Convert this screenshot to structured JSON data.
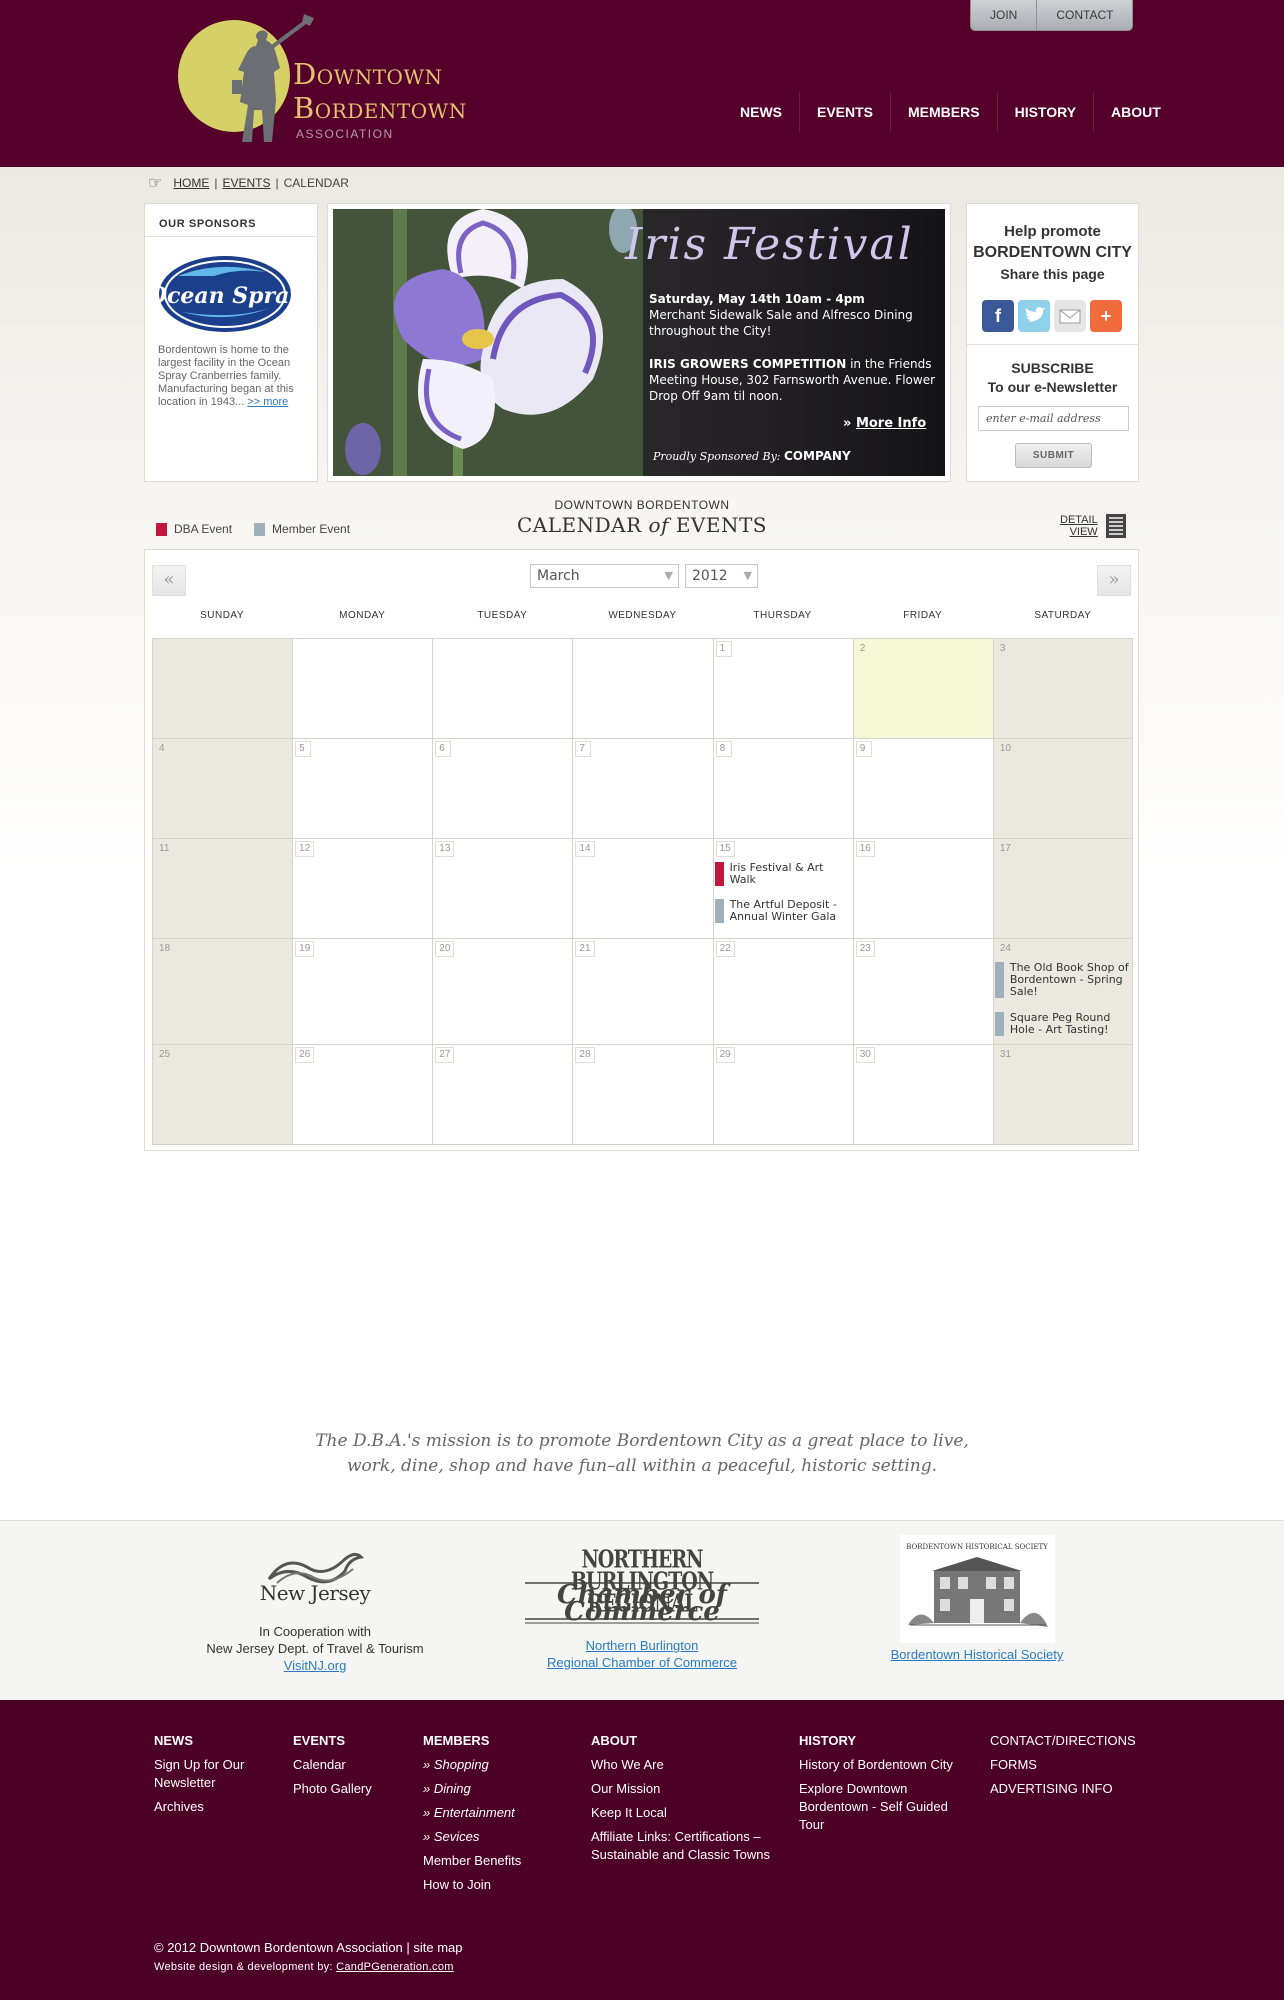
{
  "header": {
    "logo_line1": "Downtown",
    "logo_line2": "Bordentown",
    "logo_sub": "ASSOCIATION",
    "util_nav": [
      "JOIN",
      "CONTACT"
    ],
    "main_nav": [
      "NEWS",
      "EVENTS",
      "MEMBERS",
      "HISTORY",
      "ABOUT"
    ]
  },
  "breadcrumb": {
    "home": "HOME",
    "sep1": "|",
    "events": "EVENTS",
    "sep2": "|",
    "current": "CALENDAR"
  },
  "sponsors": {
    "title": "OUR SPONSORS",
    "logo_text": "Ocean Spray",
    "text": "Bordentown is home to the largest facility in the Ocean Spray Cranberries family. Manufacturing began at this location in 1943...",
    "more": ">> more"
  },
  "hero": {
    "title": "Iris Festival",
    "line1": "Saturday, May 14th 10am - 4pm",
    "line2": "Merchant Sidewalk Sale and Alfresco Dining throughout the City!",
    "line3_bold": "IRIS GROWERS COMPETITION",
    "line3_rest": " in the Friends Meeting House, 302 Farnsworth Avenue. Flower Drop Off 9am til noon.",
    "more_prefix": "» ",
    "more": "More Info",
    "sponsor_label": "Proudly Sponsored By: ",
    "sponsor_name": "COMPANY"
  },
  "promote": {
    "line1": "Help promote",
    "line2": "BORDENTOWN CITY",
    "line3": "Share this page",
    "share_icons": [
      "facebook-icon",
      "twitter-icon",
      "email-icon",
      "addthis-icon"
    ],
    "subscribe_l1": "SUBSCRIBE",
    "subscribe_l2": "To our e-Newsletter",
    "email_placeholder": "enter e-mail address",
    "submit": "SUBMIT"
  },
  "legend": [
    {
      "label": "DBA Event",
      "color": "#c4173f"
    },
    {
      "label": "Member Event",
      "color": "#9fb0ba"
    }
  ],
  "calendar": {
    "org": "DOWNTOWN BORDENTOWN",
    "title_a": "CALENDAR ",
    "title_of": "of",
    "title_b": " EVENTS",
    "detail_view_1": "DETAIL",
    "detail_view_2": "VIEW",
    "prev": "«",
    "next": "»",
    "month": "March",
    "year": "2012",
    "weekdays": [
      "SUNDAY",
      "MONDAY",
      "TUESDAY",
      "WEDNESDAY",
      "THURSDAY",
      "FRIDAY",
      "SATURDAY"
    ],
    "weeks": [
      [
        "",
        "",
        "",
        "",
        "1",
        "2",
        "3"
      ],
      [
        "4",
        "5",
        "6",
        "7",
        "8",
        "9",
        "10"
      ],
      [
        "11",
        "12",
        "13",
        "14",
        "15",
        "16",
        "17"
      ],
      [
        "18",
        "19",
        "20",
        "21",
        "22",
        "23",
        "24"
      ],
      [
        "25",
        "26",
        "27",
        "28",
        "29",
        "30",
        "31"
      ]
    ],
    "today": "2",
    "events": [
      {
        "day": "15",
        "type": "dba",
        "title": "Iris Festival & Art Walk"
      },
      {
        "day": "15",
        "type": "member",
        "title": "The Artful Deposit - Annual Winter Gala"
      },
      {
        "day": "24",
        "type": "member",
        "title": "The Old Book Shop of Bordentown - Spring Sale!"
      },
      {
        "day": "24",
        "type": "member",
        "title": "Square Peg Round Hole - Art Tasting!"
      }
    ]
  },
  "mission": {
    "line1": "The D.B.A.'s mission is to promote Bordentown City as a great place to live,",
    "line2": "work, dine, shop and have fun–all within a peaceful, historic setting."
  },
  "partners": {
    "nj_logo": "New Jersey",
    "nj_l1": "In Cooperation with",
    "nj_l2": "New Jersey Dept. of Travel & Tourism",
    "nj_link": "VisitNJ.org",
    "chamber_logo_1": "NORTHERN BURLINGTON REGIONAL",
    "chamber_logo_2": "Chamber of Commerce",
    "chamber_link_1": "Northern Burlington",
    "chamber_link_2": "Regional Chamber of Commerce",
    "hist_logo": "BORDENTOWN HISTORICAL SOCIETY",
    "hist_link": "Bordentown Historical Society"
  },
  "footer": {
    "news": {
      "title": "NEWS",
      "items": [
        "Sign Up for Our Newsletter",
        "Archives"
      ]
    },
    "events": {
      "title": "EVENTS",
      "items": [
        "Calendar",
        "Photo Gallery"
      ]
    },
    "members": {
      "title": "MEMBERS",
      "items": [
        "Shopping",
        "Dining",
        "Entertainment",
        "Sevices"
      ],
      "plain": [
        "Member Benefits",
        "How to Join"
      ]
    },
    "about": {
      "title": "ABOUT",
      "items": [
        "Who We Are",
        "Our Mission",
        "Keep It Local",
        "Affiliate Links: Certifications – Sustainable and Classic Towns"
      ]
    },
    "history": {
      "title": "HISTORY",
      "items": [
        "History of Bordentown City",
        "Explore Downtown Bordentown - Self Guided Tour"
      ]
    },
    "misc": [
      "CONTACT/DIRECTIONS",
      "FORMS",
      "ADVERTISING INFO"
    ],
    "copyright": "© 2012 Downtown Bordentown Association  |  site map",
    "credit_label": "Website design & development by: ",
    "credit_link": "CandPGeneration.com"
  }
}
